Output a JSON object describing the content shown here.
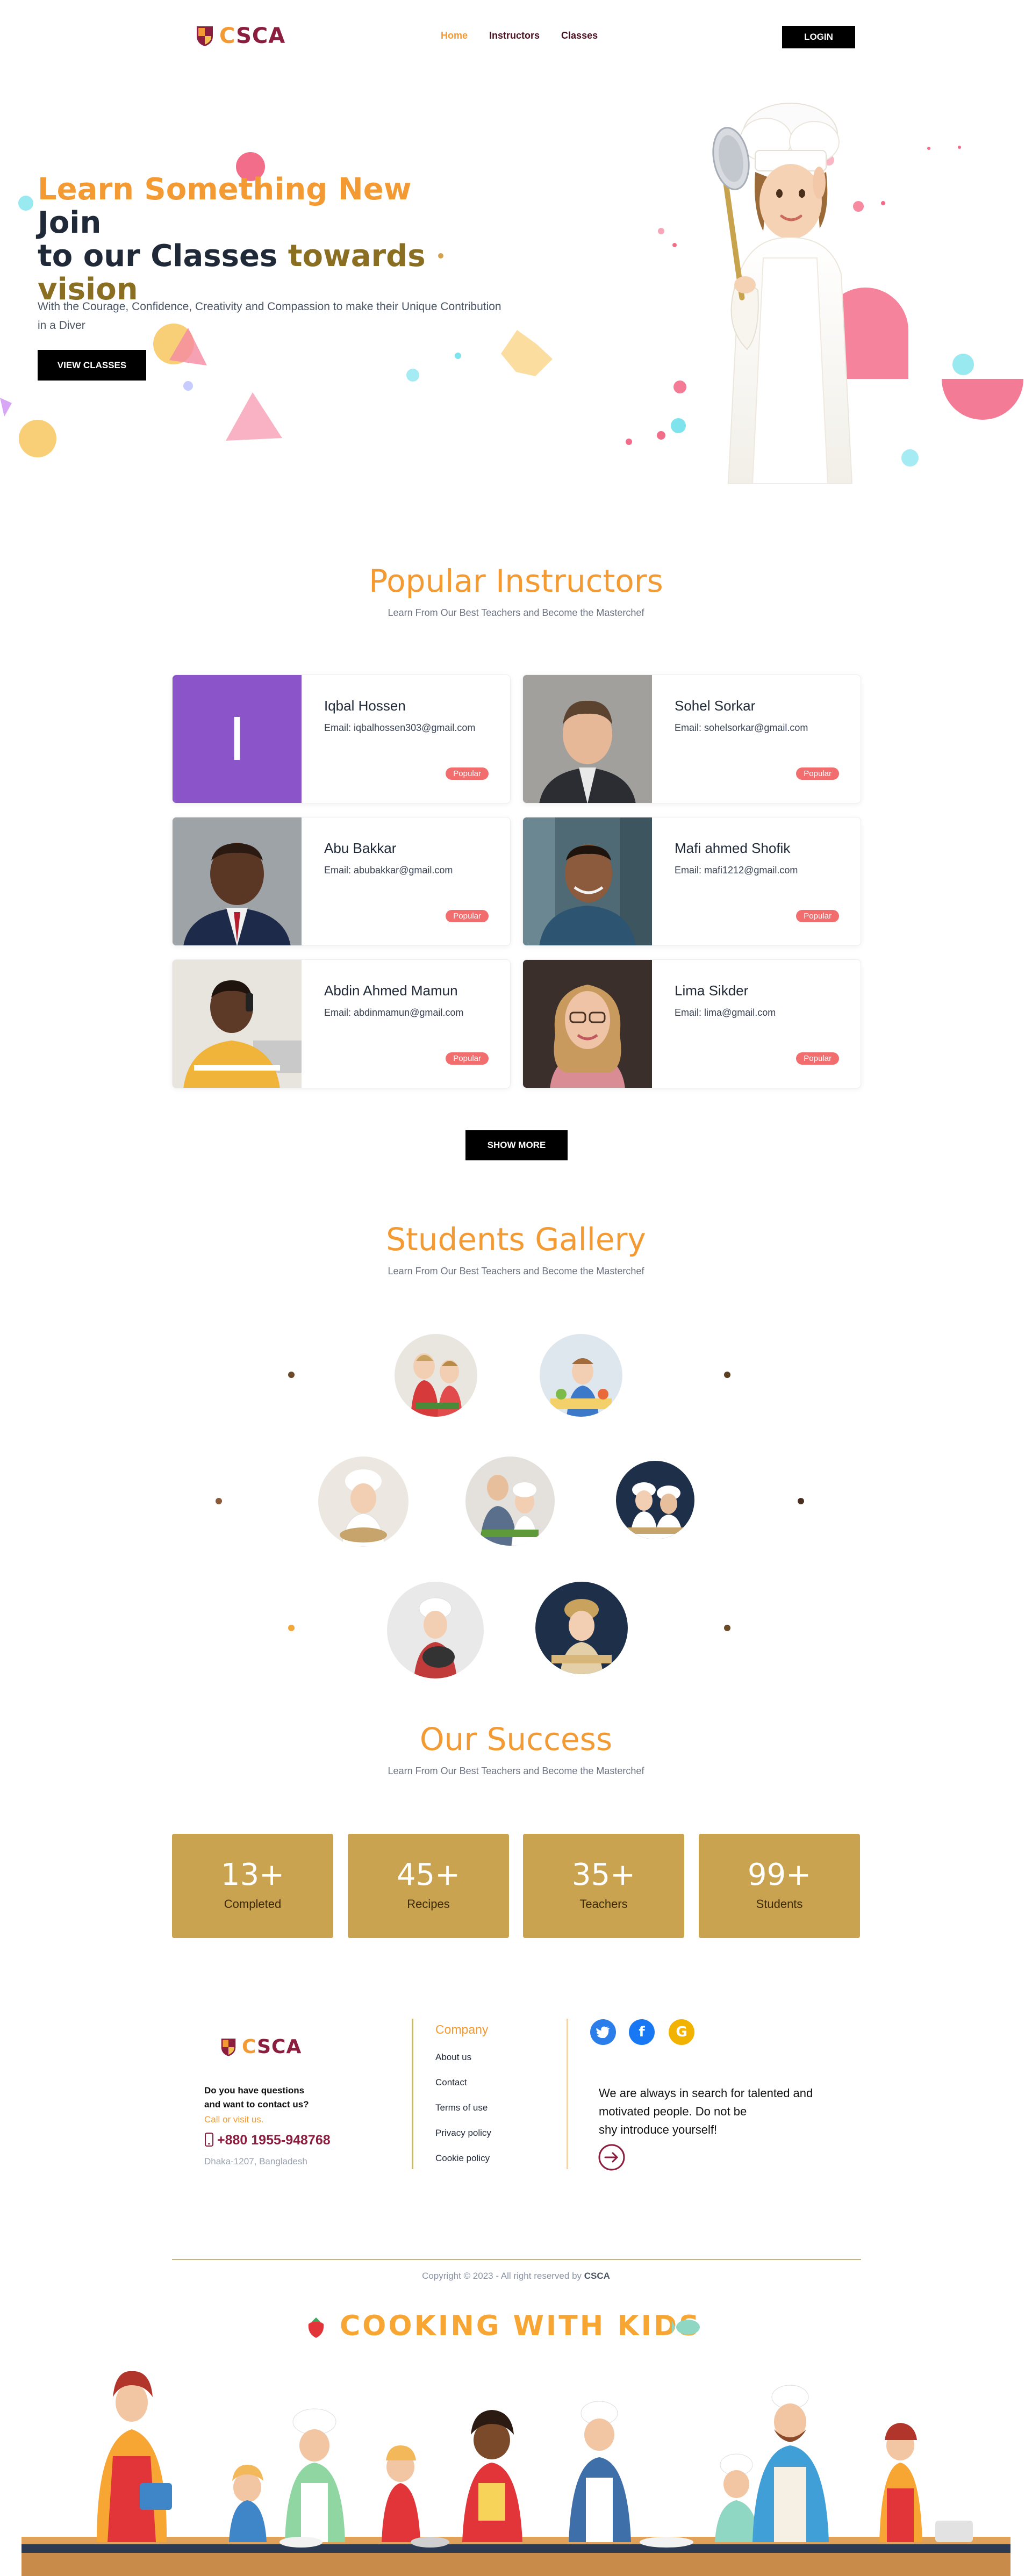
{
  "nav": {
    "brand": "CSCA",
    "links": [
      "Home",
      "Instructors",
      "Classes"
    ],
    "login_label": "LOGIN"
  },
  "hero": {
    "title_orange": "Learn Something New",
    "title_dark_1": " Join",
    "title_dark_2": "to our Classes",
    "title_gold_1": " towards",
    "title_gold_2": "vision",
    "subtitle": "With the Courage, Confidence, Creativity and Compassion to make their Unique Contribution in a Diver",
    "button_label": "VIEW CLASSES"
  },
  "instructors": {
    "title": "Popular Instructors",
    "subtitle": "Learn From Our Best Teachers and Become the Masterchef",
    "badge_label": "Popular",
    "show_more_label": "SHOW MORE",
    "items": [
      {
        "name": "Iqbal Hossen",
        "email": "Email: iqbalhossen303@gmail.com",
        "initial": "I"
      },
      {
        "name": "Sohel Sorkar",
        "email": "Email: sohelsorkar@gmail.com"
      },
      {
        "name": "Abu Bakkar",
        "email": "Email: abubakkar@gmail.com"
      },
      {
        "name": "Mafi ahmed Shofik",
        "email": "Email: mafi1212@gmail.com"
      },
      {
        "name": "Abdin Ahmed Mamun",
        "email": "Email: abdinmamun@gmail.com"
      },
      {
        "name": "Lima Sikder",
        "email": "Email: lima@gmail.com"
      }
    ]
  },
  "gallery": {
    "title": "Students Gallery",
    "subtitle": "Learn From Our Best Teachers and Become the Masterchef"
  },
  "success": {
    "title": "Our Success",
    "subtitle": "Learn From Our Best Teachers and Become the Masterchef",
    "stats": [
      {
        "num": "13+",
        "label": "Completed"
      },
      {
        "num": "45+",
        "label": "Recipes"
      },
      {
        "num": "35+",
        "label": "Teachers"
      },
      {
        "num": "99+",
        "label": "Students"
      }
    ]
  },
  "footer": {
    "brand": "CSCA",
    "question_1": "Do you have questions",
    "question_2": "and want to contact us?",
    "call_label": "Call or visit us.",
    "phone": "+880 1955-948768",
    "address": "Dhaka-1207, Bangladesh",
    "company_heading": "Company",
    "company_links": [
      "About us",
      "Contact",
      "Terms of use",
      "Privacy policy",
      "Cookie policy"
    ],
    "pitch_1": "We are always in search for talented and",
    "pitch_2": "motivated people. Do not be",
    "pitch_3": "shy introduce yourself!",
    "copyright_prefix": "Copyright © 2023 - All right reserved by ",
    "copyright_brand": "CSCA"
  },
  "banner": {
    "cooking": "COOKING",
    "with": "WITH",
    "kids": "KIDS"
  },
  "colors": {
    "accent": "#f39a32",
    "maroon": "#8b1d3f",
    "gold": "#c9a34f",
    "badge": "#f26d6d"
  }
}
